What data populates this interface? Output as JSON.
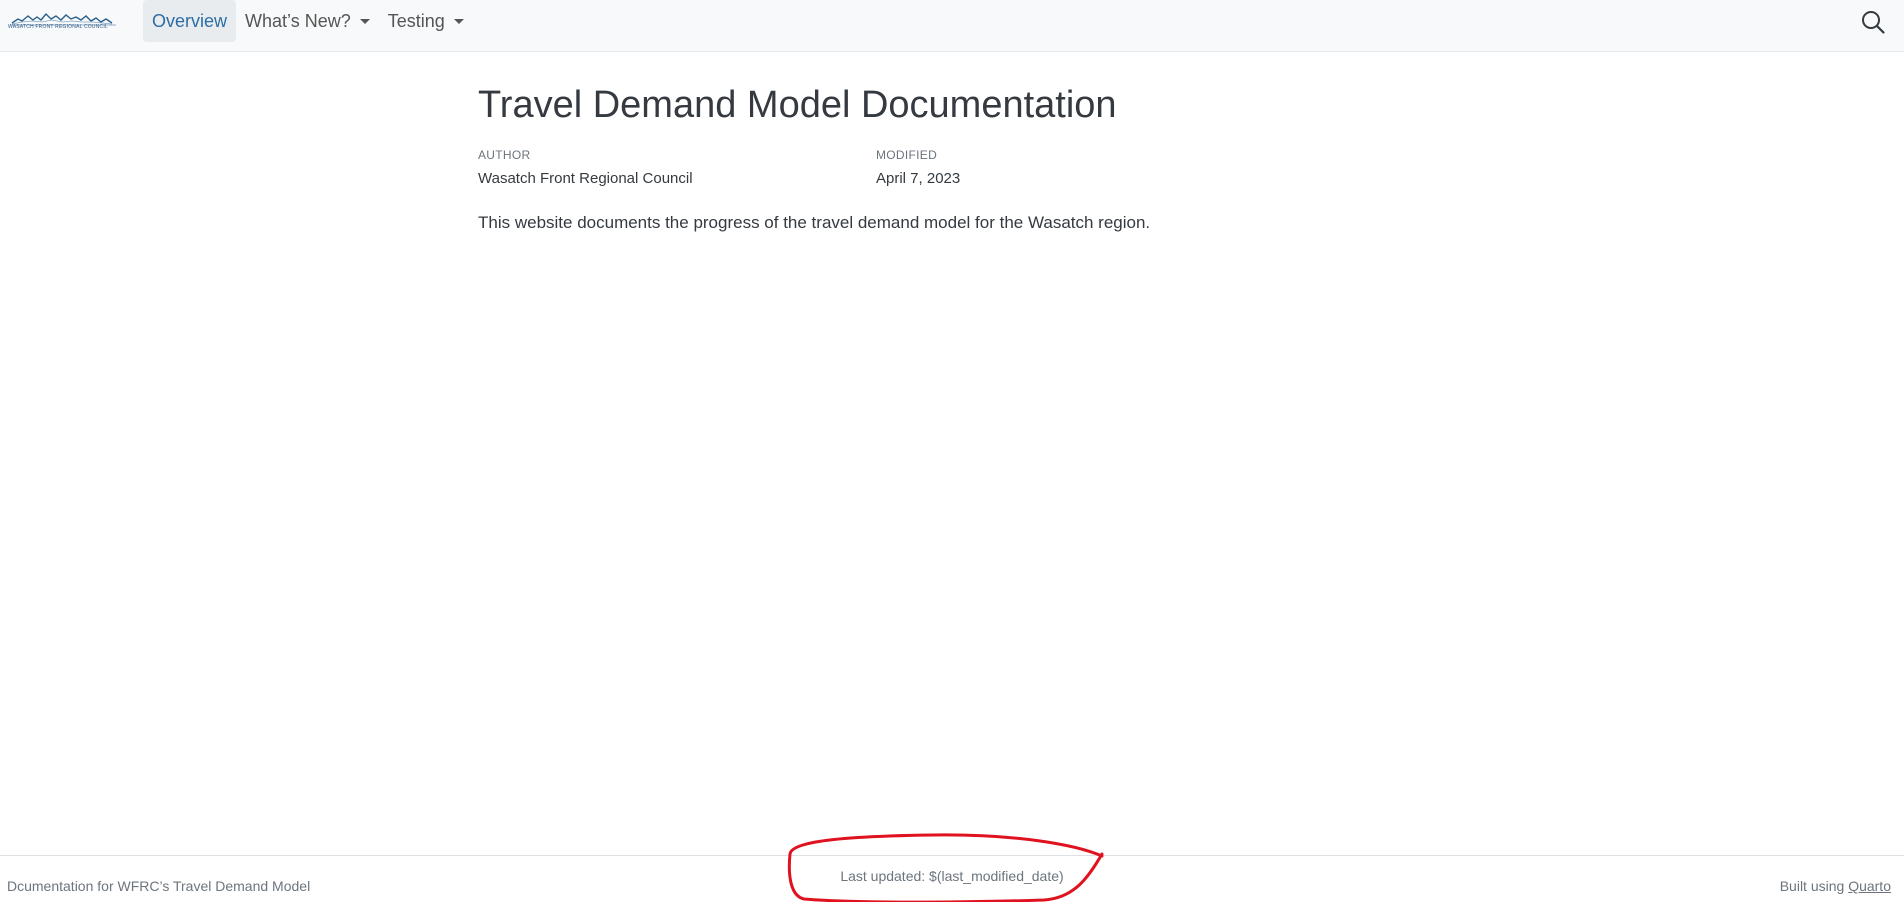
{
  "navbar": {
    "logo_text": "WASATCH FRONT REGIONAL COUNCIL",
    "items": [
      {
        "label": "Overview",
        "active": true,
        "has_dropdown": false
      },
      {
        "label": "What’s New?",
        "active": false,
        "has_dropdown": true
      },
      {
        "label": "Testing",
        "active": false,
        "has_dropdown": true
      }
    ],
    "search_icon": "search-icon"
  },
  "main": {
    "title": "Travel Demand Model Documentation",
    "author_label": "AUTHOR",
    "author": "Wasatch Front Regional Council",
    "modified_label": "MODIFIED",
    "modified": "April 7, 2023",
    "intro": "This website documents the progress of the travel demand model for the Wasatch region."
  },
  "footer": {
    "left": "Dcumentation for WFRC’s Travel Demand Model",
    "center": "Last updated: $(last_modified_date)",
    "right_prefix": "Built using ",
    "right_link": "Quarto"
  },
  "colors": {
    "active_nav": "#2c6da5",
    "navbar_bg": "#f8f9fa",
    "annotation": "#e0121f"
  }
}
